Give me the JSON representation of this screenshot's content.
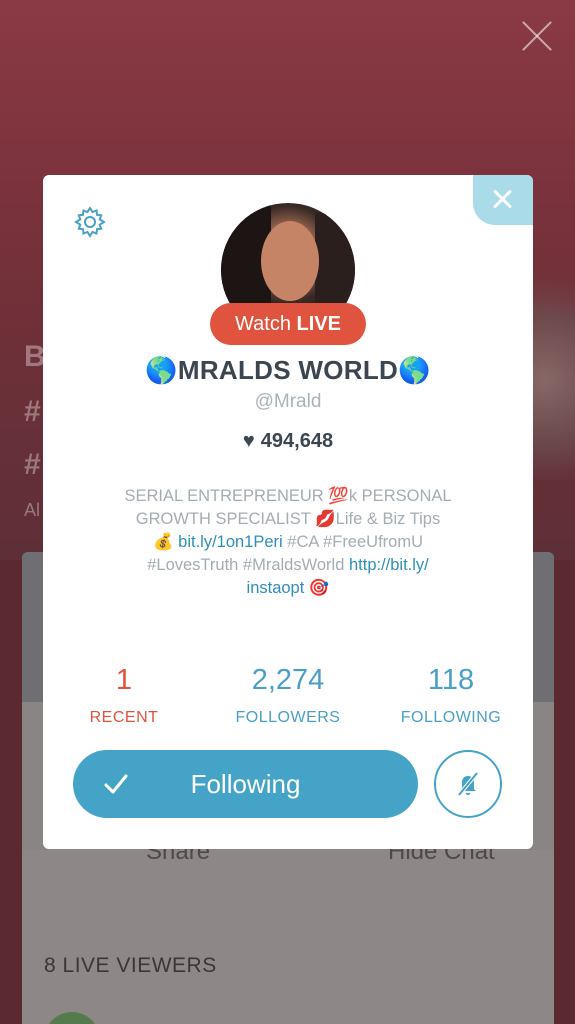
{
  "background": {
    "partial_letters": [
      "B",
      "#",
      "#",
      "Al"
    ],
    "share_label": "Share",
    "hide_chat_label": "Hide Chat",
    "live_viewers": "8 LIVE VIEWERS"
  },
  "profile": {
    "watch_live_prefix": "Watch ",
    "watch_live_bold": "LIVE",
    "name": "🌎MRALDS WORLD🌎",
    "handle": "@Mrald",
    "hearts": "494,648",
    "bio": {
      "line1": "SERIAL ENTREPRENEUR 💯k PERSONAL",
      "line2": "GROWTH SPECIALIST 💋Life & Biz Tips",
      "line3_emoji": "💰 ",
      "line3_link": "bit.ly/1on1Peri",
      "line3_rest": " #CA #FreeUfromU",
      "line4_text": "#LovesTruth  #MraldsWorld ",
      "line4_link": "http://bit.ly/",
      "line5_link": "instaopt",
      "line5_emoji": " 🎯"
    },
    "stats": {
      "recent_value": "1",
      "recent_label": "RECENT",
      "followers_value": "2,274",
      "followers_label": "FOLLOWERS",
      "following_value": "118",
      "following_label": "FOLLOWING"
    },
    "follow_button_label": "Following"
  },
  "colors": {
    "accent_blue": "#46a3c8",
    "live_red": "#e0533f",
    "close_tab": "#a9dbe9"
  },
  "icons": [
    "close-icon",
    "gear-icon",
    "heart-icon",
    "check-icon",
    "mute-notification-icon"
  ]
}
